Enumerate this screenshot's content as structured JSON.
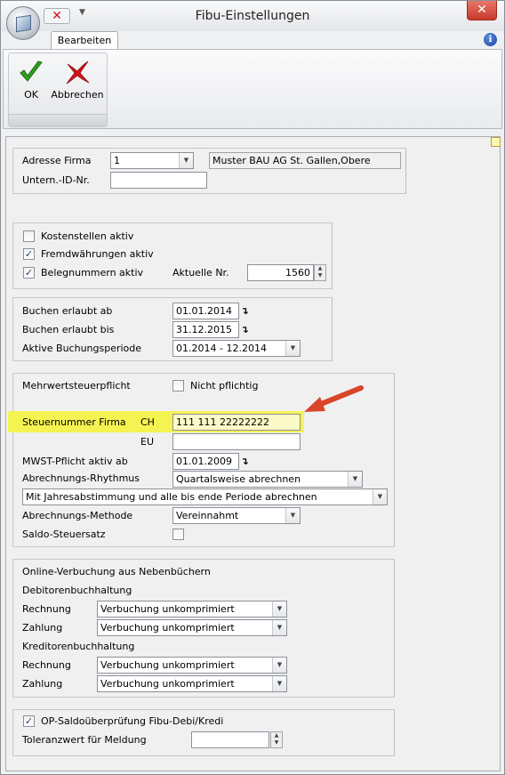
{
  "window": {
    "title": "Fibu-Einstellungen",
    "close_glyph": "✕",
    "qat_close_glyph": "✕",
    "qat_dropdown_glyph": "▼"
  },
  "ribbon": {
    "tab": "Bearbeiten",
    "help_glyph": "i",
    "ok_label": "OK",
    "cancel_label": "Abbrechen"
  },
  "firma": {
    "adresse_label": "Adresse Firma",
    "adresse_value": "1",
    "adresse_text": "Muster BAU AG St. Gallen,Obere",
    "unternid_label": "Untern.-ID-Nr.",
    "unternid_value": ""
  },
  "optionen": {
    "kostenstellen_label": "Kostenstellen aktiv",
    "kostenstellen_checked": false,
    "fremdwaehrungen_label": "Fremdwährungen aktiv",
    "fremdwaehrungen_checked": true,
    "belegnummern_label": "Belegnummern aktiv",
    "belegnummern_checked": true,
    "aktuelle_nr_label": "Aktuelle Nr.",
    "aktuelle_nr_value": "1560"
  },
  "buchung": {
    "ab_label": "Buchen erlaubt ab",
    "ab_value": "01.01.2014",
    "bis_label": "Buchen erlaubt bis",
    "bis_value": "31.12.2015",
    "periode_label": "Aktive Buchungsperiode",
    "periode_value": "01.2014 - 12.2014"
  },
  "mwst": {
    "pflicht_label": "Mehrwertsteuerpflicht",
    "nicht_pflichtig_label": "Nicht pflichtig",
    "nicht_pflichtig_checked": false,
    "steuernummer_label": "Steuernummer Firma",
    "ch_label": "CH",
    "ch_value": "111 111 22222222",
    "eu_label": "EU",
    "eu_value": "",
    "pflicht_ab_label": "MWST-Pflicht aktiv ab",
    "pflicht_ab_value": "01.01.2009",
    "rhythmus_label": "Abrechnungs-Rhythmus",
    "rhythmus_value": "Quartalsweise abrechnen",
    "jahres_value": "Mit Jahresabstimmung und alle bis ende Periode abrechnen",
    "methode_label": "Abrechnungs-Methode",
    "methode_value": "Vereinnahmt",
    "saldo_label": "Saldo-Steuersatz",
    "saldo_checked": false
  },
  "online": {
    "title": "Online-Verbuchung aus Nebenbüchern",
    "debitoren_label": "Debitorenbuchhaltung",
    "kreditoren_label": "Kreditorenbuchhaltung",
    "rechnung_label": "Rechnung",
    "zahlung_label": "Zahlung",
    "deb_rechnung_value": "Verbuchung unkomprimiert",
    "deb_zahlung_value": "Verbuchung unkomprimiert",
    "kred_rechnung_value": "Verbuchung unkomprimiert",
    "kred_zahlung_value": "Verbuchung unkomprimiert"
  },
  "op": {
    "pruefung_label": "OP-Saldoüberprüfung Fibu-Debi/Kredi",
    "pruefung_checked": true,
    "toleranz_label": "Toleranzwert für Meldung",
    "toleranz_value": ""
  },
  "colors": {
    "highlight": "#f5f352",
    "arrow": "#d9452b",
    "ok_green": "#2f9e1f",
    "cancel_red": "#d0141a"
  }
}
